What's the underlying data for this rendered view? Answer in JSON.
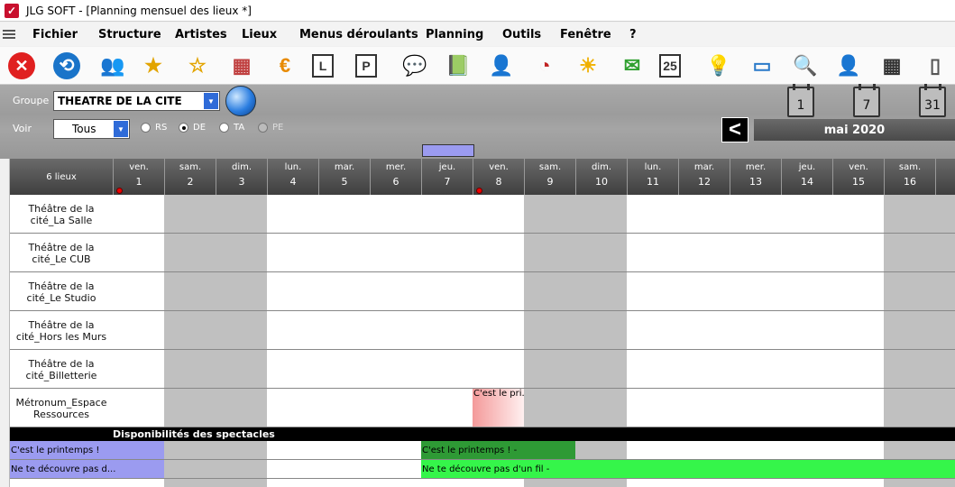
{
  "window": {
    "title": "JLG SOFT - [Planning mensuel des lieux *]"
  },
  "menu": [
    "Fichier",
    "Structure",
    "Artistes",
    "Lieux",
    "Menus déroulants",
    "Planning",
    "Outils",
    "Fenêtre",
    "?"
  ],
  "toolbar_icons": [
    {
      "name": "close-icon",
      "glyph": "✕",
      "color": "#e02020"
    },
    {
      "name": "refresh-icon",
      "glyph": "⟲",
      "color": "#1a74c9"
    },
    {
      "name": "artists-icon",
      "glyph": "👥",
      "color": "#555"
    },
    {
      "name": "star-icon",
      "glyph": "★",
      "color": "#e2a400"
    },
    {
      "name": "star-outline-icon",
      "glyph": "☆",
      "color": "#e2a400"
    },
    {
      "name": "calendar-table-icon",
      "glyph": "▦",
      "color": "#c04040"
    },
    {
      "name": "euro-icon",
      "glyph": "€",
      "color": "#e88a00"
    },
    {
      "name": "letter-l-icon",
      "glyph": "L",
      "color": "#333"
    },
    {
      "name": "letter-p-icon",
      "glyph": "P",
      "color": "#333"
    },
    {
      "name": "chat-user-icon",
      "glyph": "💬",
      "color": "#2aa02a"
    },
    {
      "name": "contact-book-icon",
      "glyph": "📗",
      "color": "#2aa02a"
    },
    {
      "name": "user-euro-icon",
      "glyph": "👤",
      "color": "#2b5fa8"
    },
    {
      "name": "gauge-icon",
      "glyph": "◔",
      "color": "#c02020"
    },
    {
      "name": "sun-icon",
      "glyph": "☀",
      "color": "#f0b000"
    },
    {
      "name": "envelope-icon",
      "glyph": "✉",
      "color": "#30a030"
    },
    {
      "name": "day-calendar-icon",
      "glyph": "25",
      "color": "#333"
    },
    {
      "name": "lightbulb-icon",
      "glyph": "💡",
      "color": "#777"
    },
    {
      "name": "card-icon",
      "glyph": "▭",
      "color": "#2a7ac9"
    },
    {
      "name": "zoom-icon",
      "glyph": "🔍",
      "color": "#555"
    },
    {
      "name": "person-icon",
      "glyph": "👤",
      "color": "#2b5fa8"
    },
    {
      "name": "calendar-icon",
      "glyph": "▦",
      "color": "#333"
    },
    {
      "name": "document-icon",
      "glyph": "▯",
      "color": "#555"
    }
  ],
  "filters": {
    "groupe_label": "Groupe",
    "groupe_value": "THEATRE DE LA CITE",
    "voir_label": "Voir",
    "voir_value": "Tous",
    "radios": [
      {
        "label": "RS",
        "selected": false,
        "enabled": true
      },
      {
        "label": "DE",
        "selected": true,
        "enabled": true
      },
      {
        "label": "TA",
        "selected": false,
        "enabled": true
      },
      {
        "label": "PE",
        "selected": false,
        "enabled": false
      }
    ]
  },
  "view_buttons": [
    "1",
    "7",
    "31"
  ],
  "month": "mai 2020",
  "grid": {
    "corner": "6 lieux",
    "days": [
      {
        "name": "ven.",
        "num": "1",
        "weekend": false,
        "mark": true
      },
      {
        "name": "sam.",
        "num": "2",
        "weekend": true,
        "mark": false
      },
      {
        "name": "dim.",
        "num": "3",
        "weekend": true,
        "mark": false
      },
      {
        "name": "lun.",
        "num": "4",
        "weekend": false,
        "mark": false
      },
      {
        "name": "mar.",
        "num": "5",
        "weekend": false,
        "mark": false
      },
      {
        "name": "mer.",
        "num": "6",
        "weekend": false,
        "mark": false
      },
      {
        "name": "jeu.",
        "num": "7",
        "weekend": false,
        "mark": false
      },
      {
        "name": "ven.",
        "num": "8",
        "weekend": false,
        "mark": true
      },
      {
        "name": "sam.",
        "num": "9",
        "weekend": true,
        "mark": false
      },
      {
        "name": "dim.",
        "num": "10",
        "weekend": true,
        "mark": false
      },
      {
        "name": "lun.",
        "num": "11",
        "weekend": false,
        "mark": false
      },
      {
        "name": "mar.",
        "num": "12",
        "weekend": false,
        "mark": false
      },
      {
        "name": "mer.",
        "num": "13",
        "weekend": false,
        "mark": false
      },
      {
        "name": "jeu.",
        "num": "14",
        "weekend": false,
        "mark": false
      },
      {
        "name": "ven.",
        "num": "15",
        "weekend": false,
        "mark": false
      },
      {
        "name": "sam.",
        "num": "16",
        "weekend": true,
        "mark": false
      },
      {
        "name": "d",
        "num": "",
        "weekend": true,
        "mark": false
      }
    ],
    "venues": [
      "Théâtre de la cité_La Salle",
      "Théâtre de la cité_Le CUB",
      "Théâtre de la cité_Le Studio",
      "Théâtre de la cité_Hors les Murs",
      "Théâtre de la cité_Billetterie",
      "Métronum_Espace Ressources"
    ],
    "events": [
      {
        "venue": 5,
        "day": 7,
        "span": 1,
        "label": "C'est le pri...",
        "color": "#f49a9a"
      }
    ],
    "section_title": "Disponibilités des spectacles",
    "availability": [
      {
        "row": 0,
        "segments": [
          {
            "day": 0,
            "span": 1,
            "label": "C'est le printemps !",
            "color": "#9b9bf0"
          },
          {
            "day": 6,
            "span": 3,
            "label": "C'est le printemps ! -",
            "color": "#2e9a35"
          }
        ]
      },
      {
        "row": 1,
        "segments": [
          {
            "day": 0,
            "span": 1,
            "label": "Ne te découvre pas d...",
            "color": "#9b9bf0"
          },
          {
            "day": 6,
            "span": 11,
            "label": "Ne te découvre pas d'un fil -",
            "color": "#35f54a"
          }
        ]
      }
    ]
  }
}
